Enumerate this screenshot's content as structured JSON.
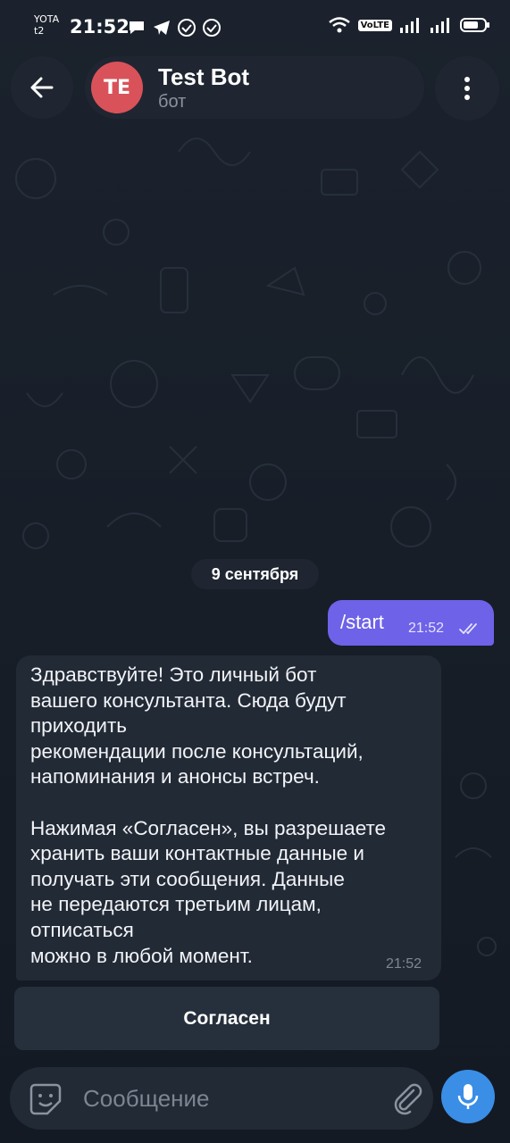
{
  "status_bar": {
    "carrier_top": "YOTA",
    "carrier_bottom": "t2",
    "time": "21:52",
    "volte_label": "VoLTE",
    "battery": "battery-icon"
  },
  "header": {
    "avatar_initials": "TE",
    "avatar_color": "#d9525a",
    "title": "Test Bot",
    "subtitle": "бот"
  },
  "chat": {
    "date_badge": "9 сентября",
    "outgoing": {
      "text": "/start",
      "time": "21:52",
      "status": "read",
      "bubble_color": "#6e62e8"
    },
    "incoming": {
      "text": "Здравствуйте! Это личный бот\nвашего консультанта. Сюда будут\nприходить\nрекомендации после консультаций,\nнапоминания и анонсы встреч.\n\nНажимая «Согласен», вы разрешаете\nхранить ваши контактные данные и\nполучать эти сообщения. Данные\nне передаются третьим лицам,\nотписаться\nможно в любой момент.",
      "time": "21:52"
    },
    "keyboard_button": "Согласен"
  },
  "composer": {
    "placeholder": "Сообщение",
    "accent": "#3a8ee6"
  }
}
